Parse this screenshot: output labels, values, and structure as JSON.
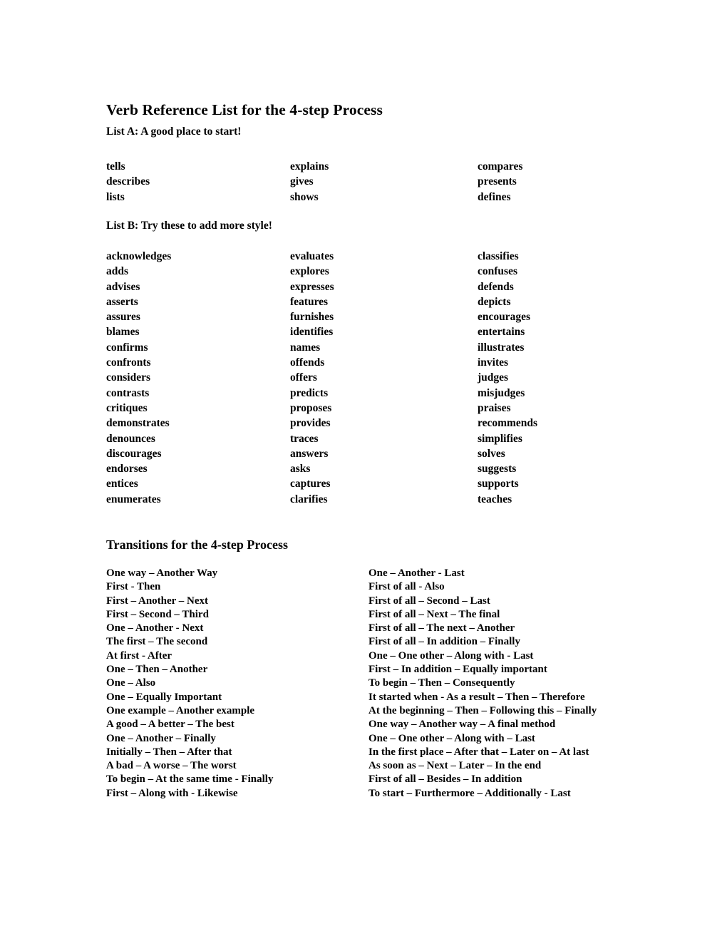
{
  "document": {
    "title": "Verb Reference List for the 4-step Process"
  },
  "list_a": {
    "heading": "List A: A good place to start!",
    "columns": [
      [
        "tells",
        "describes",
        "lists"
      ],
      [
        "explains",
        "gives",
        "shows"
      ],
      [
        "compares",
        "presents",
        "defines"
      ]
    ]
  },
  "list_b": {
    "heading": "List B: Try these to add more style!",
    "columns": [
      [
        "acknowledges",
        "adds",
        "advises",
        "asserts",
        "assures",
        "blames",
        "confirms",
        "confronts",
        "considers",
        "contrasts",
        "critiques",
        "demonstrates",
        "denounces",
        "discourages",
        "endorses",
        "entices",
        "enumerates"
      ],
      [
        "evaluates",
        "explores",
        "expresses",
        "features",
        "furnishes",
        "identifies",
        "names",
        "offends",
        "offers",
        "predicts",
        "proposes",
        "provides",
        "traces",
        "answers",
        "asks",
        "captures",
        "clarifies"
      ],
      [
        "classifies",
        "confuses",
        "defends",
        "depicts",
        "encourages",
        "entertains",
        "illustrates",
        "invites",
        "judges",
        "misjudges",
        "praises",
        "recommends",
        "simplifies",
        "solves",
        "suggests",
        "supports",
        "teaches"
      ]
    ]
  },
  "transitions": {
    "heading": "Transitions for the 4-step Process",
    "columns": [
      [
        "One way – Another Way",
        "First - Then",
        "First – Another – Next",
        "First – Second – Third",
        "One – Another - Next",
        "The first – The second",
        "At first - After",
        "One – Then – Another",
        "One – Also",
        "One – Equally Important",
        "One example – Another example",
        "A good – A better – The best",
        "One – Another – Finally",
        "Initially – Then – After that",
        "A bad – A worse – The worst",
        "To begin – At the same time - Finally",
        "First – Along with - Likewise"
      ],
      [
        "One – Another - Last",
        "First of all - Also",
        "First of all – Second – Last",
        "First of all – Next – The final",
        "First of all – The next – Another",
        "First of all – In addition – Finally",
        "One – One other – Along with - Last",
        "First – In addition – Equally important",
        "To begin – Then – Consequently",
        "It started when - As a result – Then – Therefore",
        "At the beginning – Then – Following this – Finally",
        "One way – Another way – A final method",
        "One – One other – Along with – Last",
        "In the first place – After that – Later on – At last",
        "As soon as – Next – Later – In the end",
        "First of all – Besides – In addition",
        "To start – Furthermore – Additionally - Last"
      ]
    ]
  }
}
